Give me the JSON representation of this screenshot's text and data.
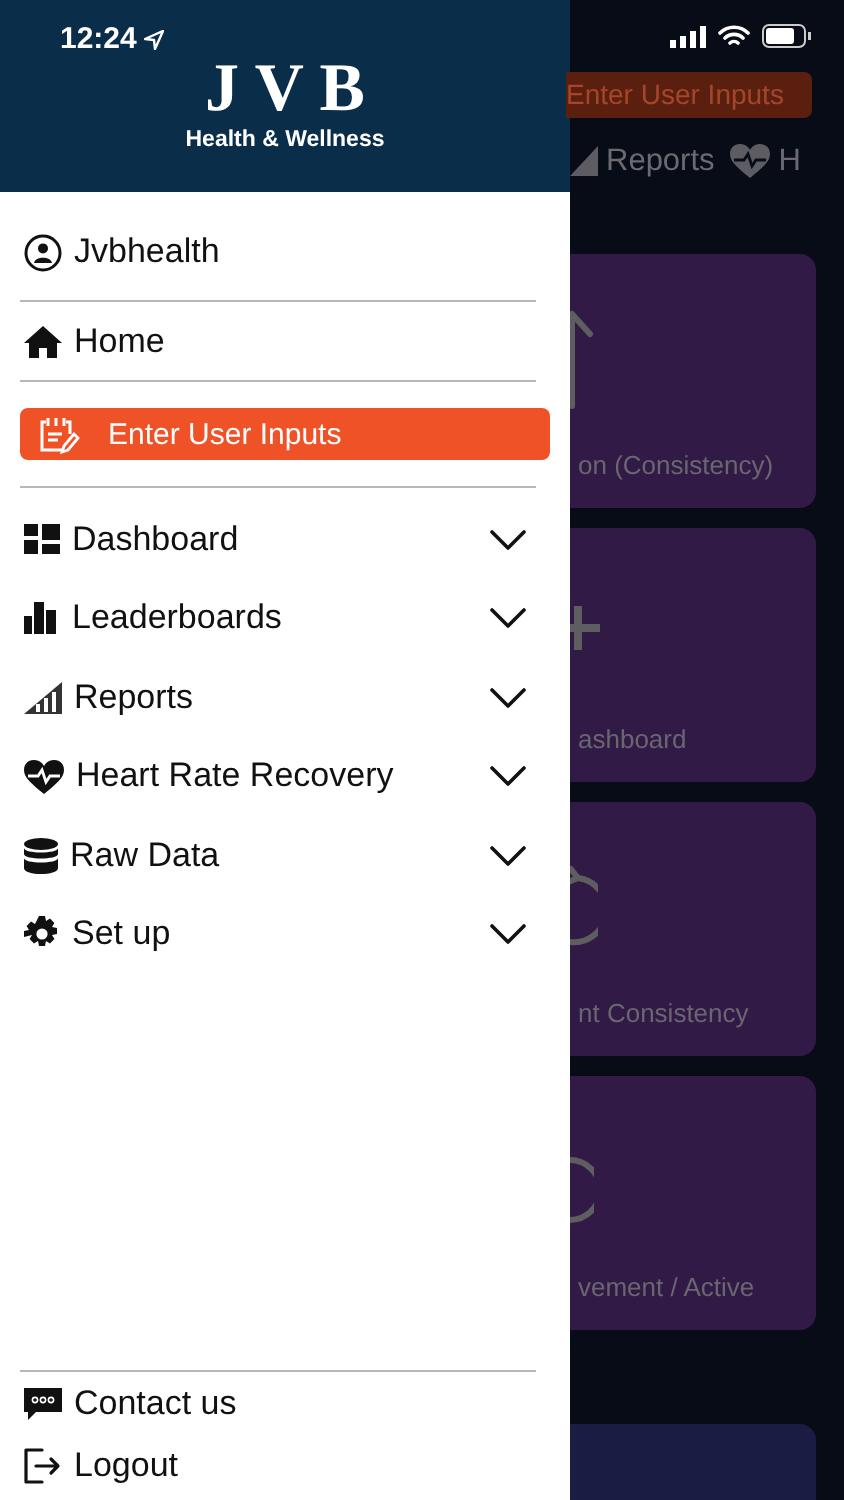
{
  "status_bar": {
    "time": "12:24"
  },
  "drawer": {
    "logo": {
      "title": "J V B",
      "subtitle": "Health & Wellness"
    },
    "account": {
      "label": "Jvbhealth"
    },
    "home": {
      "label": "Home"
    },
    "primary_button": {
      "label": "Enter User Inputs"
    },
    "menu": [
      {
        "label": "Dashboard",
        "expanded": false
      },
      {
        "label": "Leaderboards",
        "expanded": false
      },
      {
        "label": "Reports",
        "expanded": false
      },
      {
        "label": "Heart Rate Recovery",
        "expanded": false
      },
      {
        "label": "Raw Data",
        "expanded": false
      },
      {
        "label": "Set up",
        "expanded": false
      }
    ],
    "footer": [
      {
        "label": "Contact us"
      },
      {
        "label": "Logout"
      }
    ]
  },
  "background": {
    "button": {
      "label": "Enter User Inputs"
    },
    "tabs": [
      {
        "label": "Reports"
      },
      {
        "label": "H"
      }
    ],
    "cards": [
      {
        "label": "on (Consistency)"
      },
      {
        "label": "ashboard"
      },
      {
        "label": "nt Consistency"
      },
      {
        "label": "vement / Active"
      }
    ]
  }
}
